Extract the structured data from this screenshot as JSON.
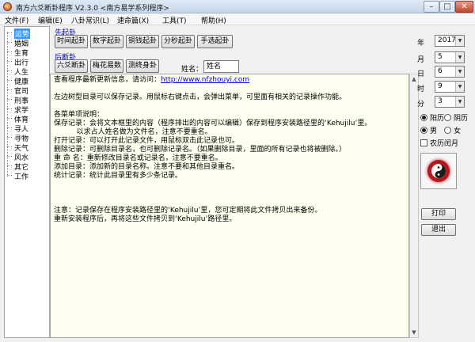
{
  "window": {
    "title": "南方六爻断卦程序 V2.3.0  <南方易学系列程序>"
  },
  "menu": [
    "文件(F)",
    "编辑(E)",
    "八卦常识(L)",
    "速命篇(X)",
    "工具(T)",
    "帮助(H)"
  ],
  "tree": {
    "items": [
      "运势",
      "婚姻",
      "生育",
      "出行",
      "人生",
      "健康",
      "官司",
      "刑事",
      "求学",
      "体育",
      "寻人",
      "寻物",
      "天气",
      "风水",
      "其它",
      "工作"
    ],
    "selected_index": 0
  },
  "first_group": {
    "label": "先起卦",
    "buttons": [
      "时间起卦",
      "数字起卦",
      "铜钱起卦",
      "分秒起卦",
      "手选起卦"
    ]
  },
  "second_group": {
    "label": "后断卦",
    "buttons": [
      "六爻断卦",
      "梅花易数",
      "测终身卦"
    ]
  },
  "name_field": {
    "label": "姓名：",
    "value": "姓名"
  },
  "text": {
    "link_prefix": "查看程序最新更新信息，请访问：",
    "link": "http://www.nfzhouyi.com",
    "lines": [
      "",
      "左边树型目录可以保存记录。用鼠标右键点击，会弹出菜单，可里面有相关的记录操作功能。",
      "",
      "各菜单项说明：",
      "保存记录：会将文本框里的内容（程序排出的内容可以编辑）保存到程序安装路径里的‘Kehujilu’里。",
      "          以求占人姓名做为文件名，注意不要重名。",
      "打开记录：可以打开此记录文件，用鼠标双击此记录也可。",
      "删除记录：可删除目录名，也可删除记录名。（如果删除目录，里面的所有记录也将被删除。）",
      "重 命 名：重新修改目录名或记录名，注意不要重名。",
      "添加目录：添加新的目录名称。注意不要和其他目录重名。",
      "统计记录：统计此目录里有多少条记录。",
      "",
      "",
      "",
      "注意：记录保存在程序安装路径里的‘Kehujilu’里，您可定期将此文件拷贝出来备份。",
      "重新安装程序后，再将这些文件拷贝到‘Kehujilu’路径里。"
    ]
  },
  "datetime": {
    "year_label": "年",
    "year": "2017",
    "month_label": "月",
    "month": "5",
    "day_label": "日",
    "day": "6",
    "hour_label": "时",
    "hour": "9",
    "minute_label": "分",
    "minute": "3"
  },
  "calendar": {
    "solar": "阳历",
    "lunar": "阴历",
    "selected": "solar"
  },
  "gender": {
    "male": "男",
    "female": "女",
    "selected": "male"
  },
  "leap_month": {
    "label": "农历闰月",
    "checked": false
  },
  "actions": {
    "print": "打印",
    "exit": "退出"
  },
  "icons": {
    "title": "taiji-icon",
    "dropdown": "chevron-down-icon",
    "scroll_up": "arrow-up-icon",
    "scroll_down": "arrow-down-icon"
  },
  "colors": {
    "link": "#0000ee",
    "group_label": "#0000cc",
    "selection": "#3399ff",
    "taiji": "#b8171b"
  }
}
